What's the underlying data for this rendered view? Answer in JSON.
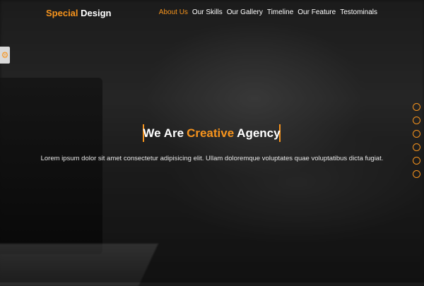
{
  "logo": {
    "part1": "Special",
    "part2": "Design"
  },
  "nav": {
    "items": [
      {
        "label": "About Us"
      },
      {
        "label": "Our Skills"
      },
      {
        "label": "Our Gallery"
      },
      {
        "label": "Timeline"
      },
      {
        "label": "Our Feature"
      },
      {
        "label": "Testominals"
      }
    ]
  },
  "hero": {
    "title_before": "We Are",
    "title_accent": "Creative",
    "title_after": "Agency",
    "tagline": "Lorem ipsum dolor sit amet consectetur adipisicing elit. Ullam doloremque voluptates quae voluptatibus dicta fugiat."
  },
  "settings": {
    "icon": "gear-icon"
  },
  "bullets": {
    "count": 6
  },
  "colors": {
    "accent": "#f7941d",
    "text": "#ffffff"
  }
}
